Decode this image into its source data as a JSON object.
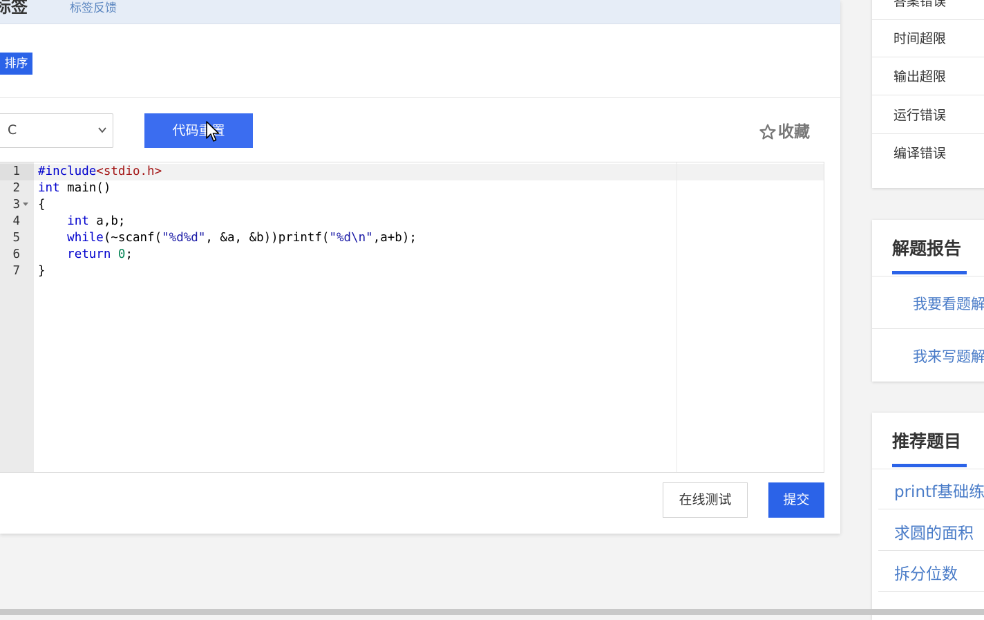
{
  "tags": {
    "title": "标签",
    "feedback_link": "标签反馈",
    "chip": "排序"
  },
  "toolbar": {
    "language": "C",
    "reset_label": "代码重置",
    "favorite_label": "收藏"
  },
  "editor": {
    "line_numbers": [
      "1",
      "2",
      "3",
      "4",
      "5",
      "6",
      "7"
    ]
  },
  "actions": {
    "test_label": "在线测试",
    "submit_label": "提交"
  },
  "sidebar": {
    "status_items": [
      "答案错误",
      "时间超限",
      "输出超限",
      "运行错误",
      "编译错误"
    ],
    "report": {
      "title": "解题报告",
      "links": [
        "我要看题解",
        "我来写题解"
      ]
    },
    "recommend": {
      "title": "推荐题目",
      "links": [
        "printf基础练习",
        "求圆的面积",
        "拆分位数"
      ]
    }
  },
  "colors": {
    "accent": "#2b63e8",
    "link": "#4a7cc8"
  }
}
